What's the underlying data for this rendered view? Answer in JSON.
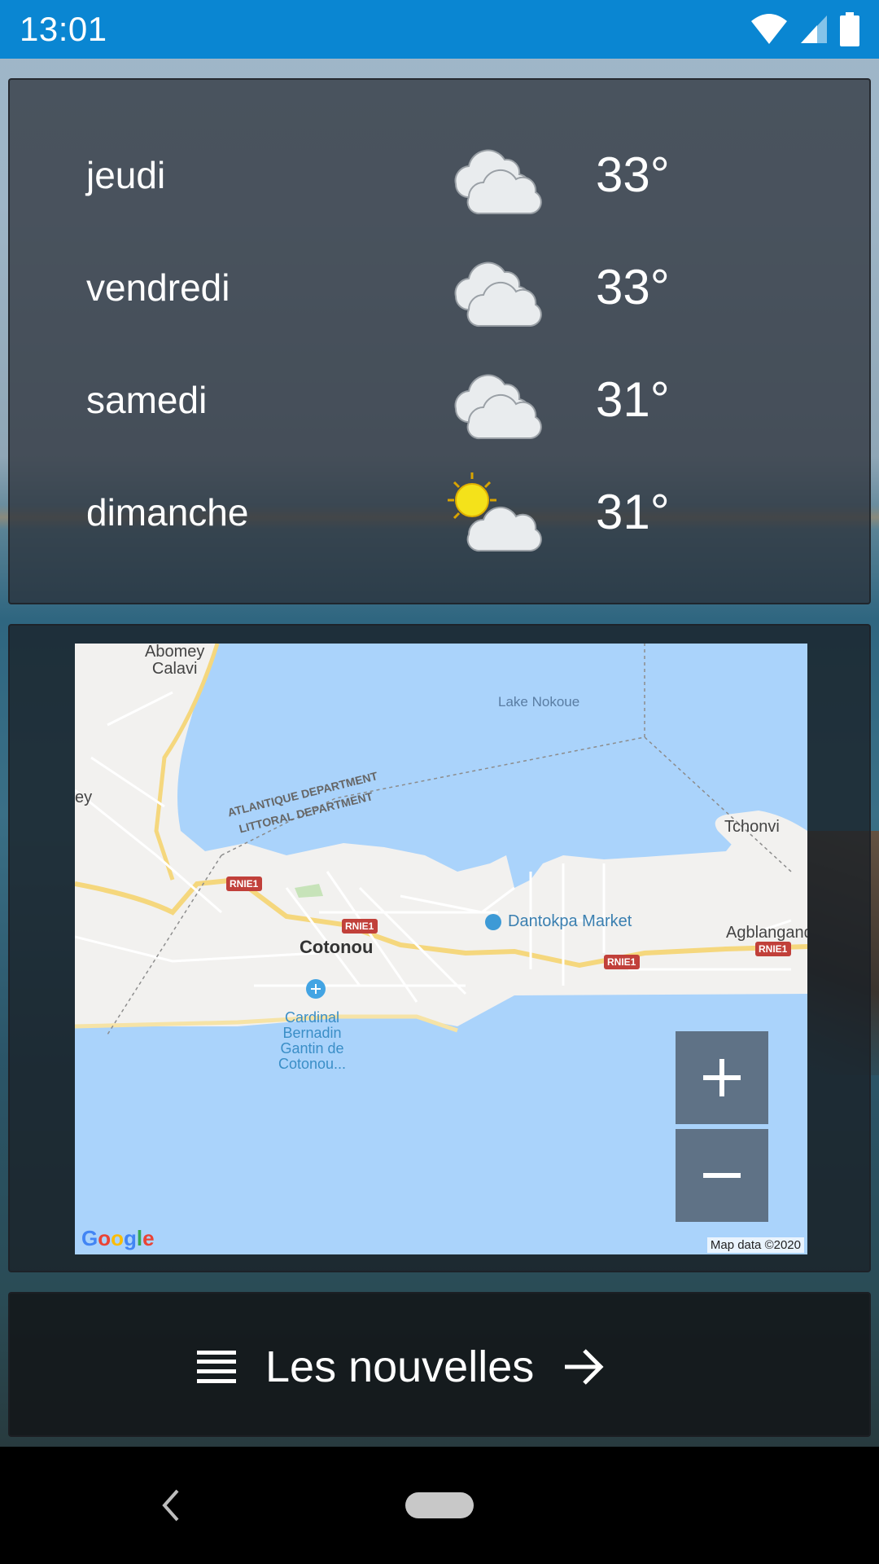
{
  "status_bar": {
    "time": "13:01",
    "background": "#0a86d2",
    "icons": [
      "wifi-icon",
      "cell-signal-icon",
      "battery-icon"
    ]
  },
  "forecast": {
    "days": [
      {
        "day": "jeudi",
        "temp": "33°",
        "icon": "cloudy-icon"
      },
      {
        "day": "vendredi",
        "temp": "33°",
        "icon": "cloudy-icon"
      },
      {
        "day": "samedi",
        "temp": "31°",
        "icon": "cloudy-icon"
      },
      {
        "day": "dimanche",
        "temp": "31°",
        "icon": "partly-sunny-icon"
      }
    ]
  },
  "map": {
    "labels": {
      "abomey_calavi": "Abomey\nCalavi",
      "lake": "Lake Nokoue",
      "ey": "ey",
      "atlantique": "ATLANTIQUE DEPARTMENT",
      "littoral": "LITTORAL DEPARTMENT",
      "tchonvi": "Tchonvi",
      "rnie1": "RNIE1",
      "dantokpa": "Dantokpa Market",
      "cotonou": "Cotonou",
      "agblangan": "Agblangand",
      "airport": "Cardinal\nBernadin\nGantin de\nCotonou..."
    },
    "zoom_in": "+",
    "zoom_out": "−",
    "logo": "Google",
    "credit": "Map data ©2020",
    "water_color": "#aad3fb",
    "land_color": "#f2f1ef"
  },
  "news": {
    "label": "Les nouvelles"
  },
  "nav": {
    "icons": [
      "back-icon",
      "home-pill"
    ]
  }
}
